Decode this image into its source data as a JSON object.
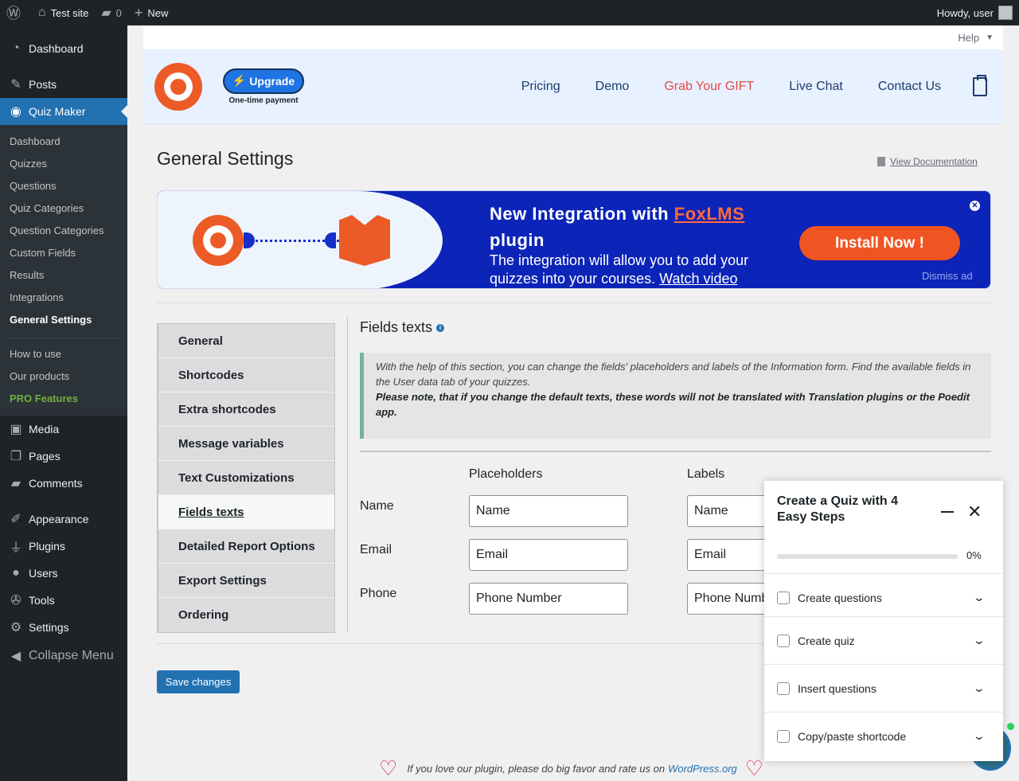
{
  "adminbar": {
    "site_name": "Test site",
    "comments_count": "0",
    "new_label": "New",
    "howdy": "Howdy, user"
  },
  "sidebar": {
    "top": [
      {
        "label": "Dashboard",
        "icon": "dashboard-icon"
      },
      {
        "label": "Posts",
        "icon": "pin-icon"
      },
      {
        "label": "Quiz Maker",
        "icon": "quiz-maker-icon",
        "active": true
      }
    ],
    "submenu": [
      "Dashboard",
      "Quizzes",
      "Questions",
      "Quiz Categories",
      "Question Categories",
      "Custom Fields",
      "Results",
      "Integrations",
      "General Settings"
    ],
    "submenu2": [
      "How to use",
      "Our products",
      "PRO Features"
    ],
    "bottom": [
      {
        "label": "Media",
        "icon": "media-icon"
      },
      {
        "label": "Pages",
        "icon": "pages-icon"
      },
      {
        "label": "Comments",
        "icon": "comments-icon"
      },
      {
        "label": "Appearance",
        "icon": "appearance-icon"
      },
      {
        "label": "Plugins",
        "icon": "plugins-icon"
      },
      {
        "label": "Users",
        "icon": "users-icon"
      },
      {
        "label": "Tools",
        "icon": "tools-icon"
      },
      {
        "label": "Settings",
        "icon": "settings-icon"
      },
      {
        "label": "Collapse Menu",
        "icon": "collapse-icon"
      }
    ]
  },
  "help_label": "Help",
  "header": {
    "upgrade_label": "Upgrade",
    "upgrade_sub": "One-time payment",
    "nav": [
      "Pricing",
      "Demo",
      "Grab Your GIFT",
      "Live Chat",
      "Contact Us"
    ]
  },
  "page": {
    "title": "General Settings",
    "view_doc": "View Documentation"
  },
  "banner": {
    "title_prefix": "New Integration with",
    "title_link": "FoxLMS",
    "title_suffix": "plugin",
    "desc": "The integration will allow you to add your quizzes into your courses.",
    "watch": "Watch video",
    "install": "Install Now !",
    "dismiss": "Dismiss ad"
  },
  "tabs": [
    "General",
    "Shortcodes",
    "Extra shortcodes",
    "Message variables",
    "Text Customizations",
    "Fields texts",
    "Detailed Report Options",
    "Export Settings",
    "Ordering"
  ],
  "active_tab": "Fields texts",
  "section": {
    "title": "Fields texts",
    "note_1": "With the help of this section, you can change the fields' placeholders and labels of the Information form. Find the available fields in the User data tab of your quizzes.",
    "note_2": "Please note, that if you change the default texts, these words will not be translated with Translation plugins or the Poedit app.",
    "col_placeholders": "Placeholders",
    "col_labels": "Labels",
    "rows": [
      {
        "label": "Name",
        "placeholder": "Name",
        "label_value": "Name"
      },
      {
        "label": "Email",
        "placeholder": "Email",
        "label_value": "Email"
      },
      {
        "label": "Phone",
        "placeholder": "Phone Number",
        "label_value": "Phone Number"
      }
    ]
  },
  "save_label": "Save changes",
  "footer": {
    "text": "If you love our plugin, please do big favor and rate us on",
    "link": "WordPress.org"
  },
  "steps_panel": {
    "title": "Create a Quiz with 4 Easy Steps",
    "progress": "0%",
    "progress_fraction": 0,
    "steps": [
      "Create questions",
      "Create quiz",
      "Insert questions",
      "Copy/paste shortcode"
    ]
  }
}
